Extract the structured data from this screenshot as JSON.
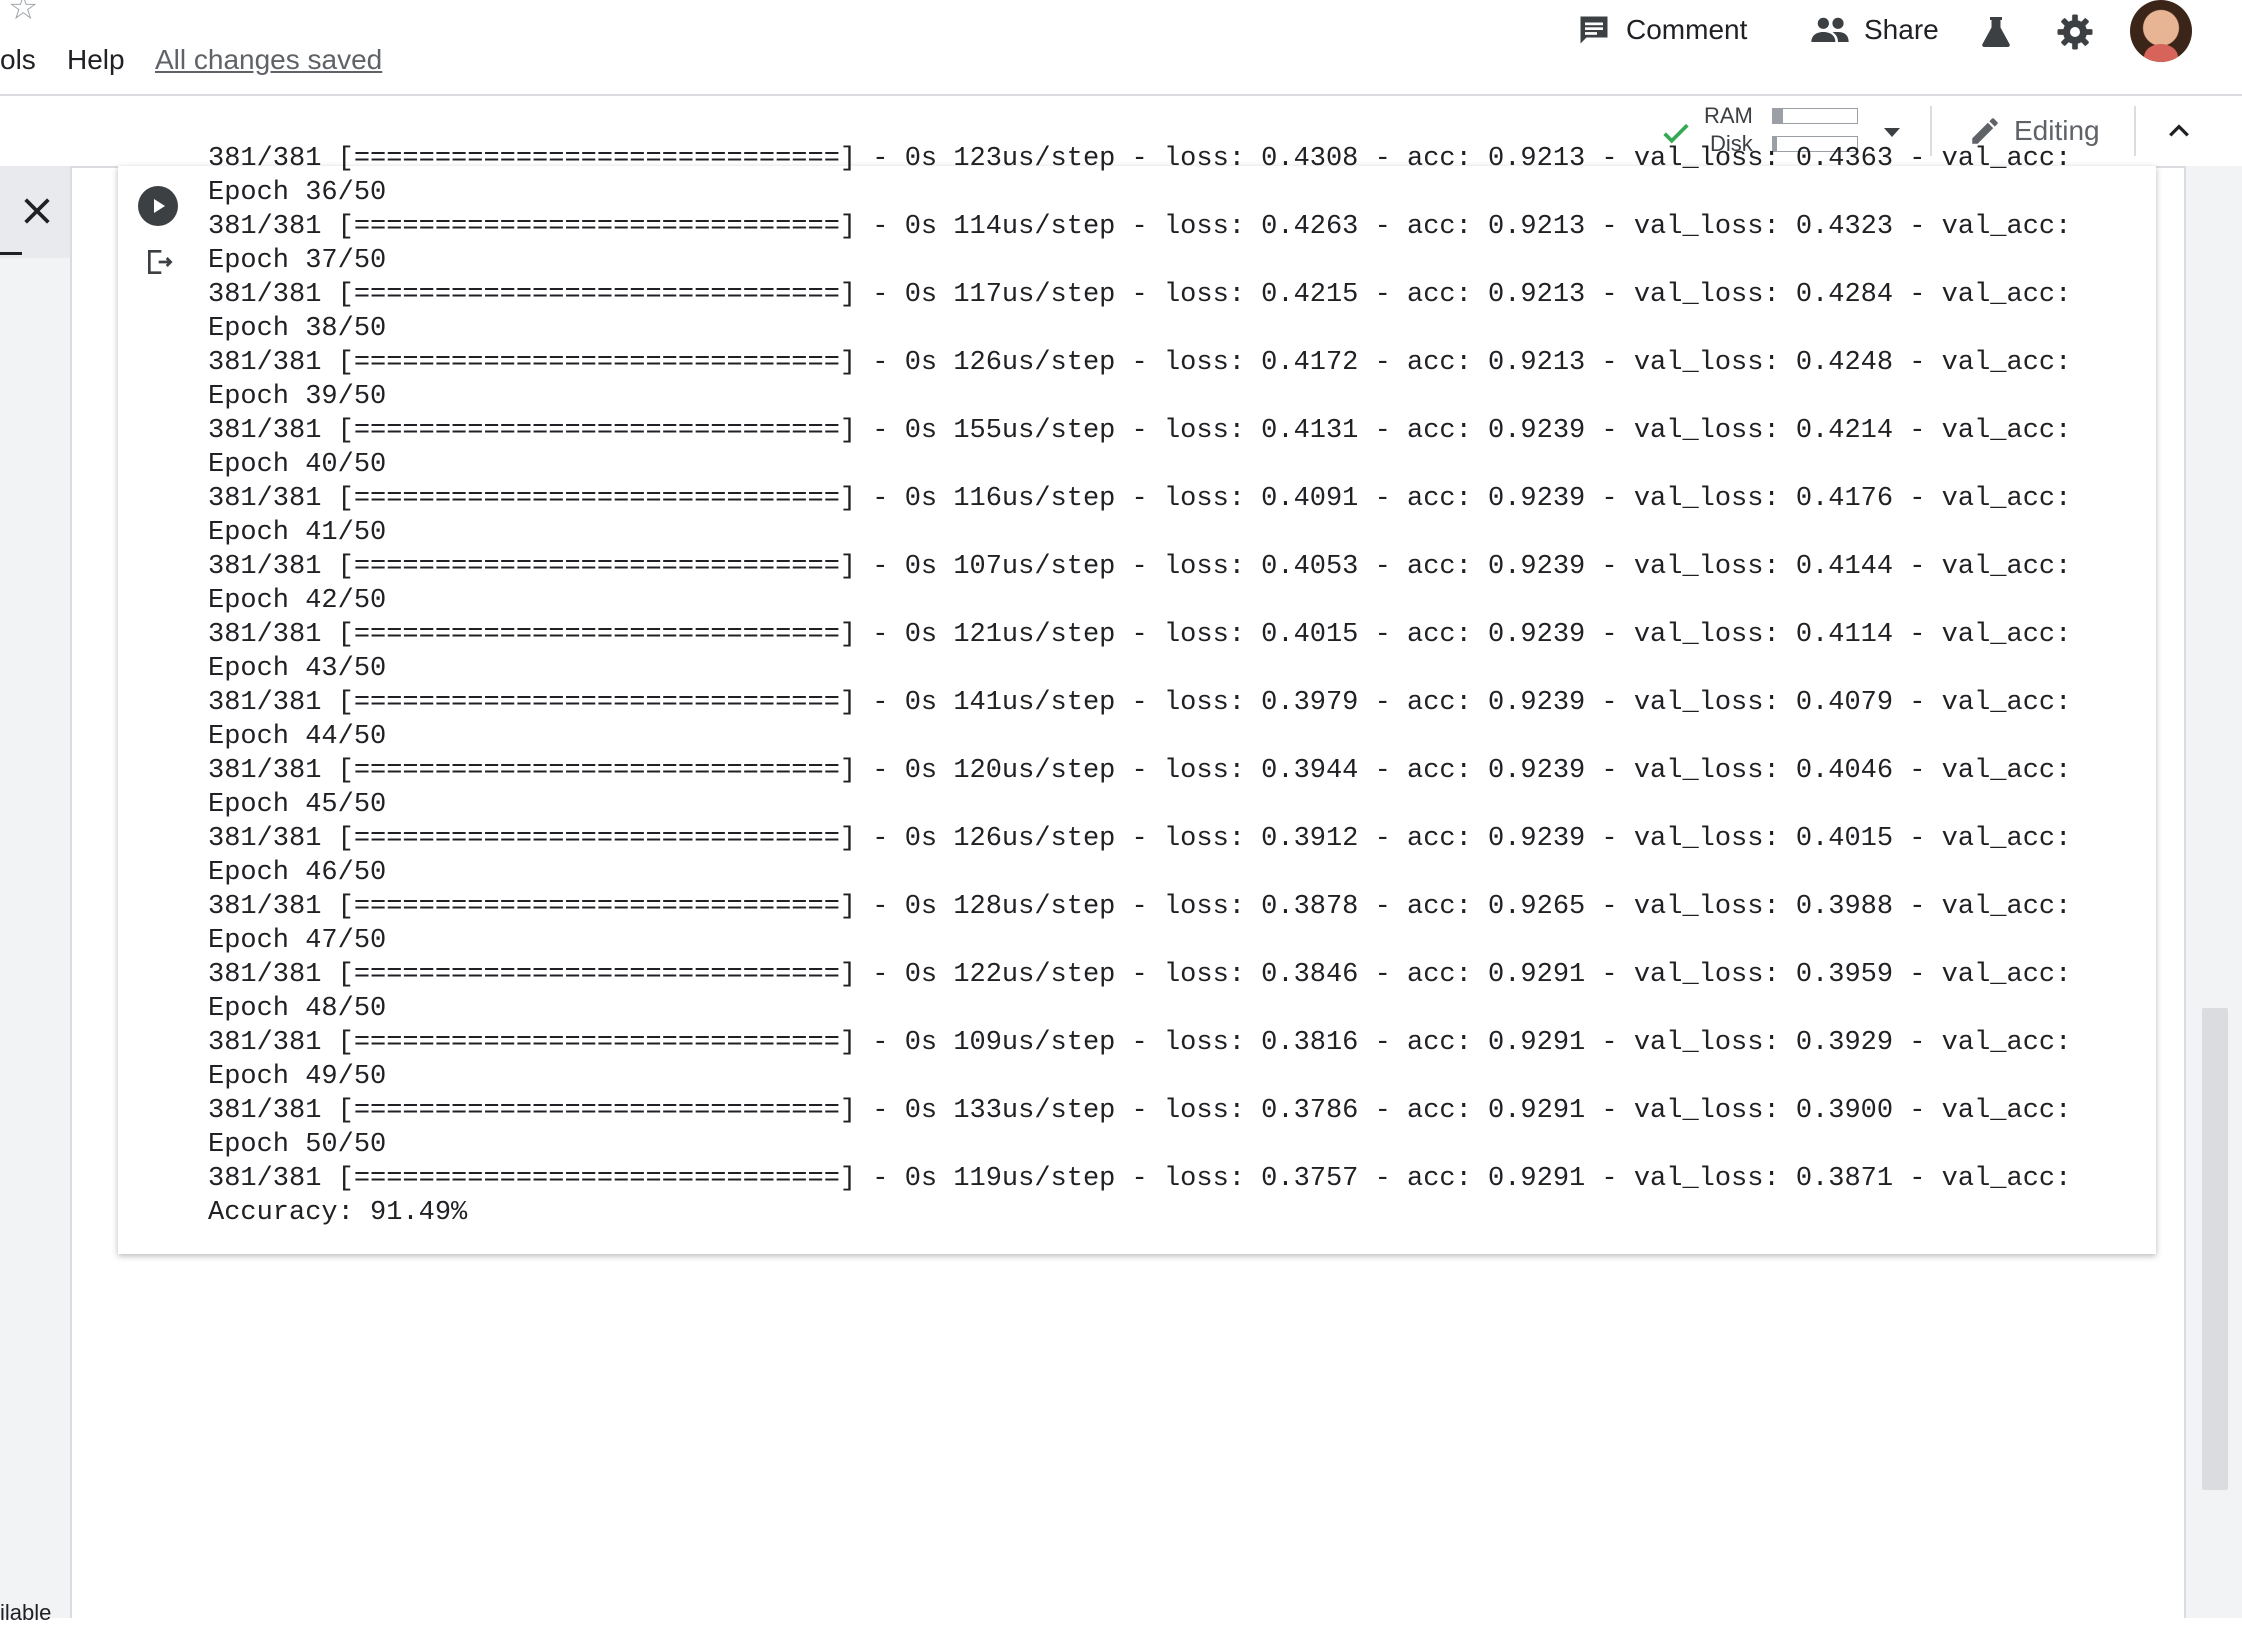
{
  "menu": {
    "tools_label": "ols",
    "help_label": "Help",
    "save_status": "All changes saved"
  },
  "header": {
    "comment_label": "Comment",
    "share_label": "Share",
    "icons": [
      "star-icon",
      "comment-icon",
      "people-icon",
      "labs-flask-icon",
      "gear-icon",
      "avatar"
    ]
  },
  "toolbar": {
    "ram_label": "RAM",
    "disk_label": "Disk",
    "ram_usage": 0.12,
    "disk_usage": 0.05,
    "editing_label": "Editing"
  },
  "left_panel": {
    "footer_text": "ilable"
  },
  "colors": {
    "accent_check": "#34a853",
    "text": "#202124",
    "muted": "#5f6368"
  },
  "output": {
    "lines": [
      "381/381 [==============================] - 0s 123us/step - loss: 0.4308 - acc: 0.9213 - val_loss: 0.4363 - val_acc:",
      "Epoch 36/50",
      "381/381 [==============================] - 0s 114us/step - loss: 0.4263 - acc: 0.9213 - val_loss: 0.4323 - val_acc:",
      "Epoch 37/50",
      "381/381 [==============================] - 0s 117us/step - loss: 0.4215 - acc: 0.9213 - val_loss: 0.4284 - val_acc:",
      "Epoch 38/50",
      "381/381 [==============================] - 0s 126us/step - loss: 0.4172 - acc: 0.9213 - val_loss: 0.4248 - val_acc:",
      "Epoch 39/50",
      "381/381 [==============================] - 0s 155us/step - loss: 0.4131 - acc: 0.9239 - val_loss: 0.4214 - val_acc:",
      "Epoch 40/50",
      "381/381 [==============================] - 0s 116us/step - loss: 0.4091 - acc: 0.9239 - val_loss: 0.4176 - val_acc:",
      "Epoch 41/50",
      "381/381 [==============================] - 0s 107us/step - loss: 0.4053 - acc: 0.9239 - val_loss: 0.4144 - val_acc:",
      "Epoch 42/50",
      "381/381 [==============================] - 0s 121us/step - loss: 0.4015 - acc: 0.9239 - val_loss: 0.4114 - val_acc:",
      "Epoch 43/50",
      "381/381 [==============================] - 0s 141us/step - loss: 0.3979 - acc: 0.9239 - val_loss: 0.4079 - val_acc:",
      "Epoch 44/50",
      "381/381 [==============================] - 0s 120us/step - loss: 0.3944 - acc: 0.9239 - val_loss: 0.4046 - val_acc:",
      "Epoch 45/50",
      "381/381 [==============================] - 0s 126us/step - loss: 0.3912 - acc: 0.9239 - val_loss: 0.4015 - val_acc:",
      "Epoch 46/50",
      "381/381 [==============================] - 0s 128us/step - loss: 0.3878 - acc: 0.9265 - val_loss: 0.3988 - val_acc:",
      "Epoch 47/50",
      "381/381 [==============================] - 0s 122us/step - loss: 0.3846 - acc: 0.9291 - val_loss: 0.3959 - val_acc:",
      "Epoch 48/50",
      "381/381 [==============================] - 0s 109us/step - loss: 0.3816 - acc: 0.9291 - val_loss: 0.3929 - val_acc:",
      "Epoch 49/50",
      "381/381 [==============================] - 0s 133us/step - loss: 0.3786 - acc: 0.9291 - val_loss: 0.3900 - val_acc:",
      "Epoch 50/50",
      "381/381 [==============================] - 0s 119us/step - loss: 0.3757 - acc: 0.9291 - val_loss: 0.3871 - val_acc:",
      "Accuracy: 91.49%"
    ]
  }
}
